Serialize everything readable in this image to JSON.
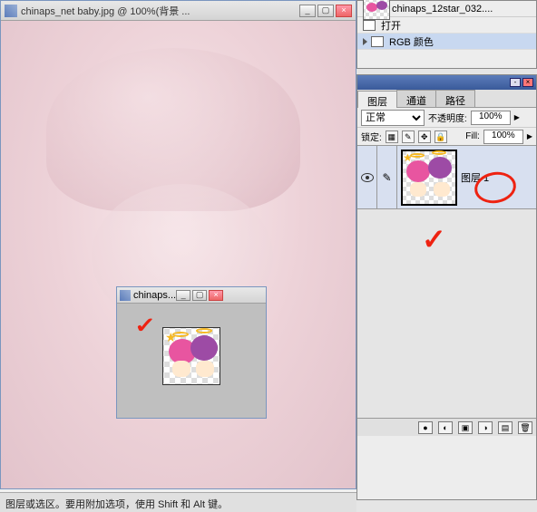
{
  "main_window": {
    "title": "chinaps_net baby.jpg @ 100%(背景 ..."
  },
  "small_window": {
    "title": "chinaps..."
  },
  "status_bar": {
    "text": "图层或选区。要用附加选项，使用 Shift 和 Alt 键。"
  },
  "history_panel": {
    "doc_name": "chinaps_12star_032....",
    "items": [
      {
        "label": "打开"
      },
      {
        "label": "RGB 颜色"
      }
    ]
  },
  "layers_panel": {
    "tabs": [
      "图层",
      "通道",
      "路径"
    ],
    "blend_mode": "正常",
    "opacity_label": "不透明度:",
    "opacity_value": "100%",
    "lock_label": "锁定:",
    "fill_label": "Fill:",
    "fill_value": "100%",
    "layers": [
      {
        "name": "图层 1"
      }
    ]
  }
}
